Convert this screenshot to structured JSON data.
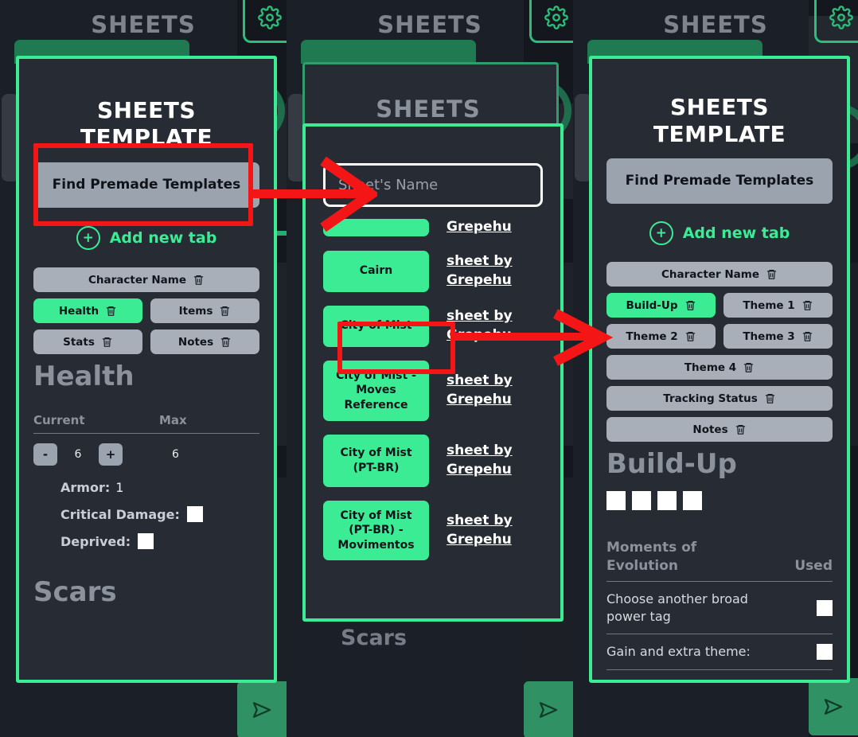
{
  "background": {
    "app_title": "SHEETS",
    "gear_icon": "gear-icon",
    "send_icon": "send-icon",
    "scars_heading": "Scars"
  },
  "panel1": {
    "title": "SHEETS\nTEMPLATE",
    "title_line1": "SHEETS",
    "title_line2": "TEMPLATE",
    "find_templates_label": "Find Premade Templates",
    "add_tab_label": "Add new tab",
    "tabs": [
      {
        "label": "Character Name",
        "active": false
      },
      {
        "label": "Health",
        "active": true
      },
      {
        "label": "Items",
        "active": false
      },
      {
        "label": "Stats",
        "active": false
      },
      {
        "label": "Notes",
        "active": false
      }
    ],
    "section_heading": "Health",
    "col_current": "Current",
    "col_max": "Max",
    "minus_label": "-",
    "plus_label": "+",
    "current_value": "6",
    "max_value": "6",
    "stats": [
      {
        "label": "Armor:",
        "value": "1",
        "checkbox": false
      },
      {
        "label": "Critical Damage:",
        "value": "",
        "checkbox": true
      },
      {
        "label": "Deprived:",
        "value": "",
        "checkbox": true
      }
    ],
    "scars_heading": "Scars"
  },
  "panel2": {
    "ghost_title": "SHEETS",
    "search_placeholder": "Sheet's Name",
    "search_value": "",
    "sheets": [
      {
        "name": "",
        "meta": "Grepehu"
      },
      {
        "name": "Cairn",
        "meta": "sheet by Grepehu"
      },
      {
        "name": "City of Mist",
        "meta": "sheet by Grepehu"
      },
      {
        "name": "City of Mist - Moves Reference",
        "meta": "sheet by Grepehu"
      },
      {
        "name": "City of Mist (PT-BR)",
        "meta": "sheet by Grepehu"
      },
      {
        "name": "City of Mist (PT-BR) - Movimentos",
        "meta": "sheet by Grepehu"
      }
    ],
    "scars_heading": "Scars"
  },
  "panel3": {
    "title_line1": "SHEETS",
    "title_line2": "TEMPLATE",
    "find_templates_label": "Find Premade Templates",
    "add_tab_label": "Add new tab",
    "tabs": [
      {
        "label": "Character Name",
        "active": false
      },
      {
        "label": "Build-Up",
        "active": true
      },
      {
        "label": "Theme 1",
        "active": false
      },
      {
        "label": "Theme 2",
        "active": false
      },
      {
        "label": "Theme 3",
        "active": false
      },
      {
        "label": "Theme 4",
        "active": false
      },
      {
        "label": "Tracking Status",
        "active": false
      },
      {
        "label": "Notes",
        "active": false
      }
    ],
    "section_heading": "Build-Up",
    "checkbox_count": 4,
    "moments_header": "Moments of Evolution",
    "used_header": "Used",
    "moments": [
      {
        "text": "Choose another broad power tag",
        "used": false
      },
      {
        "text": "Gain and extra theme:",
        "used": false
      }
    ]
  },
  "annotations": {
    "highlight_color": "#f41616",
    "box1_target": "find-premade-templates-button",
    "box2_target": "sheet-name-input",
    "box3_target": "city-of-mist-sheet-button",
    "box4_target": "build-up-tab"
  },
  "colors": {
    "accent_green": "#3bec94",
    "panel_bg": "#272c34",
    "tab_gray": "#a8afb9",
    "page_bg": "#171b22"
  }
}
